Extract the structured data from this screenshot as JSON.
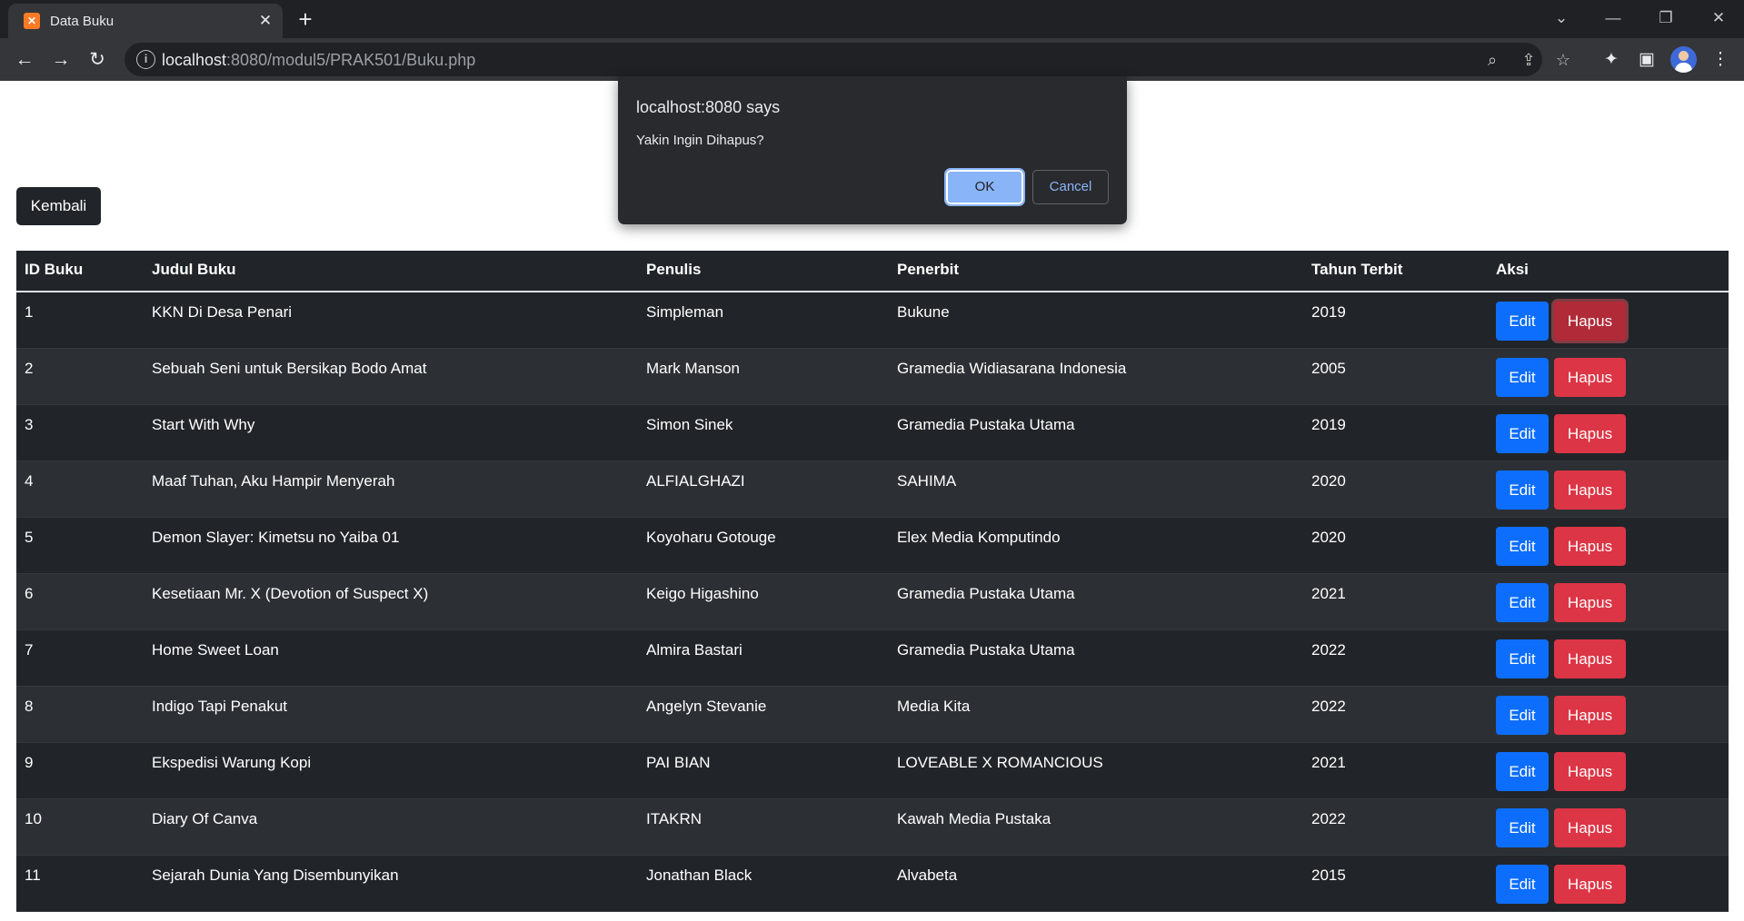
{
  "browser": {
    "tab_title": "Data Buku",
    "url_host": "localhost",
    "url_path": ":8080/modul5/PRAK501/Buku.php"
  },
  "page": {
    "back_label": "Kembali",
    "columns": [
      "ID Buku",
      "Judul Buku",
      "Penulis",
      "Penerbit",
      "Tahun Terbit",
      "Aksi"
    ],
    "rows": [
      {
        "id": "1",
        "judul": "KKN Di Desa Penari",
        "penulis": "Simpleman",
        "penerbit": "Bukune",
        "tahun": "2019"
      },
      {
        "id": "2",
        "judul": "Sebuah Seni untuk Bersikap Bodo Amat",
        "penulis": "Mark Manson",
        "penerbit": "Gramedia Widiasarana Indonesia",
        "tahun": "2005"
      },
      {
        "id": "3",
        "judul": "Start With Why",
        "penulis": "Simon Sinek",
        "penerbit": "Gramedia Pustaka Utama",
        "tahun": "2019"
      },
      {
        "id": "4",
        "judul": "Maaf Tuhan, Aku Hampir Menyerah",
        "penulis": "ALFIALGHAZI",
        "penerbit": "SAHIMA",
        "tahun": "2020"
      },
      {
        "id": "5",
        "judul": "Demon Slayer: Kimetsu no Yaiba 01",
        "penulis": "Koyoharu Gotouge",
        "penerbit": "Elex Media Komputindo",
        "tahun": "2020"
      },
      {
        "id": "6",
        "judul": "Kesetiaan Mr. X (Devotion of Suspect X)",
        "penulis": "Keigo Higashino",
        "penerbit": "Gramedia Pustaka Utama",
        "tahun": "2021"
      },
      {
        "id": "7",
        "judul": "Home Sweet Loan",
        "penulis": "Almira Bastari",
        "penerbit": "Gramedia Pustaka Utama",
        "tahun": "2022"
      },
      {
        "id": "8",
        "judul": "Indigo Tapi Penakut",
        "penulis": "Angelyn Stevanie",
        "penerbit": "Media Kita",
        "tahun": "2022"
      },
      {
        "id": "9",
        "judul": "Ekspedisi Warung Kopi",
        "penulis": "PAI BIAN",
        "penerbit": "LOVEABLE X ROMANCIOUS",
        "tahun": "2021"
      },
      {
        "id": "10",
        "judul": "Diary Of Canva",
        "penulis": "ITAKRN",
        "penerbit": "Kawah Media Pustaka",
        "tahun": "2022"
      },
      {
        "id": "11",
        "judul": "Sejarah Dunia Yang Disembunyikan",
        "penulis": "Jonathan Black",
        "penerbit": "Alvabeta",
        "tahun": "2015"
      }
    ],
    "edit_label": "Edit",
    "hapus_label": "Hapus"
  },
  "dialog": {
    "title": "localhost:8080 says",
    "message": "Yakin Ingin Dihapus?",
    "ok_label": "OK",
    "cancel_label": "Cancel"
  },
  "colors": {
    "table_bg": "#212529",
    "edit_button": "#0d6efd",
    "hapus_button": "#dc3545",
    "dialog_bg": "#292a2d",
    "dialog_ok": "#8ab4f8"
  }
}
